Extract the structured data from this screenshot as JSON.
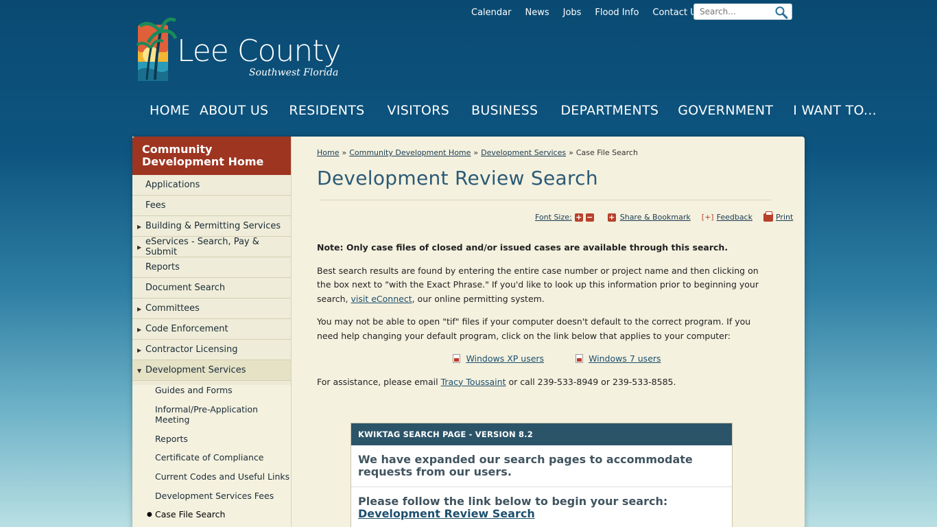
{
  "colors": {
    "header_bg": "#0a4a72",
    "sidebar_head": "#9e3520",
    "content_bg": "#f4f1df",
    "title": "#2b5a76",
    "kwik_head": "#2c5469",
    "accent_red": "#b8412b"
  },
  "util_nav": [
    "Calendar",
    "News",
    "Jobs",
    "Flood Info",
    "Contact Us"
  ],
  "search": {
    "placeholder": "Search...",
    "icon": "search-icon"
  },
  "logo": {
    "title": "Lee County",
    "subtitle": "Southwest Florida",
    "icon": "palm-tree-logo"
  },
  "main_nav": [
    "HOME",
    "ABOUT US",
    "RESIDENTS",
    "VISITORS",
    "BUSINESS",
    "DEPARTMENTS",
    "GOVERNMENT",
    "I WANT TO..."
  ],
  "sidebar": {
    "heading": "Community Development Home",
    "items": [
      {
        "label": "Applications",
        "arrow": ""
      },
      {
        "label": "Fees",
        "arrow": ""
      },
      {
        "label": "Building & Permitting Services",
        "arrow": "▶"
      },
      {
        "label": "eServices - Search, Pay & Submit",
        "arrow": "▶"
      },
      {
        "label": "Reports",
        "arrow": ""
      },
      {
        "label": "Document Search",
        "arrow": ""
      },
      {
        "label": "Committees",
        "arrow": "▶"
      },
      {
        "label": "Code Enforcement",
        "arrow": "▶"
      },
      {
        "label": "Contractor Licensing",
        "arrow": "▶"
      },
      {
        "label": "Development Services",
        "arrow": "▼"
      }
    ],
    "sub_items": [
      "Guides and Forms",
      "Informal/Pre-Application Meeting",
      "Reports",
      "Certificate of Compliance",
      "Current Codes and Useful Links",
      "Development Services Fees",
      "Case File Search"
    ]
  },
  "breadcrumb": {
    "items": [
      "Home",
      "Community Development Home",
      "Development Services"
    ],
    "current": "Case File Search",
    "separator": "»"
  },
  "page_title": "Development Review Search",
  "tools": {
    "font_size": "Font Size:",
    "plus": "+",
    "minus": "−",
    "share": "Share & Bookmark",
    "feedback_bracket": "[+]",
    "feedback": "Feedback",
    "print": "Print"
  },
  "body": {
    "note": "Note: Only case files of closed and/or issued cases are available through this search.",
    "p1_a": "Best search results are found by entering the entire case number or project name and then clicking on the box next to \"with the Exact Phrase.\" If you'd like to look up this information prior to beginning your search, ",
    "p1_link": "visit eConnect",
    "p1_b": ", our online permitting system.",
    "p2": "You may not be able to open \"tif\" files if your computer doesn't default to the correct program. If you need help changing your default program, click on the link below that applies to your computer:",
    "link_xp": "Windows XP users",
    "link_7": "Windows 7 users",
    "p3_a": "For assistance, please email ",
    "p3_link": "Tracy Toussaint",
    "p3_b": " or call 239-533-8949 or 239-533-8585."
  },
  "kwiktag": {
    "header": "KWIKTAG SEARCH PAGE - VERSION  8.2",
    "row1": "We have expanded our search pages to accommodate requests from our users.",
    "row2_text": "Please follow the link below to begin your search:",
    "row2_link": "Development Review Search"
  }
}
